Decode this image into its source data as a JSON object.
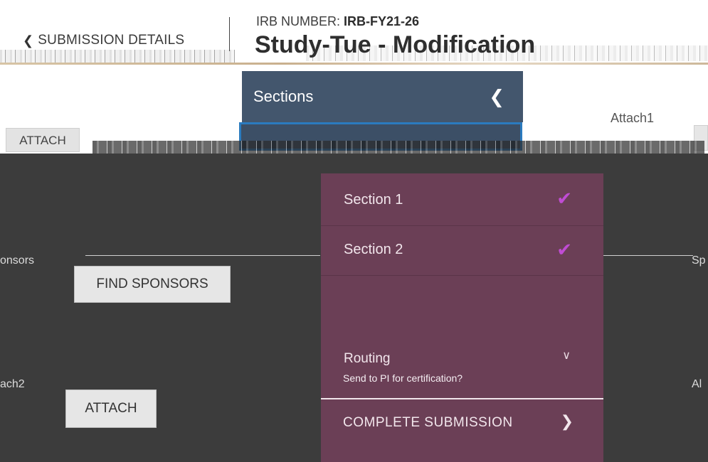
{
  "header": {
    "back_label": "SUBMISSION DETAILS",
    "irb_prefix": "IRB NUMBER:",
    "irb_number": "IRB-FY21-26",
    "title": "Study-Tue - Modification"
  },
  "sections_panel": {
    "title": "Sections"
  },
  "content": {
    "attach1_label": "Attach1",
    "attach_top_button": "ATTACH",
    "sponsors_label_left": "onsors",
    "sponsors_label_right": "Sp",
    "find_sponsors_button": "FIND SPONSORS",
    "attach2_label_left": "ach2",
    "attach2_label_right": "Al",
    "attach_button": "ATTACH"
  },
  "nav": {
    "items": [
      {
        "label": "Section 1",
        "complete": true
      },
      {
        "label": "Section 2",
        "complete": true
      }
    ],
    "routing": {
      "title": "Routing",
      "subtitle": "Send to PI for certification?"
    },
    "complete_submission": "COMPLETE SUBMISSION"
  },
  "colors": {
    "nav_bg": "#6b3f56",
    "sections_header_bg": "#43566d",
    "overlay_bg": "#3c3c3c",
    "check_color": "#c04cd3"
  }
}
